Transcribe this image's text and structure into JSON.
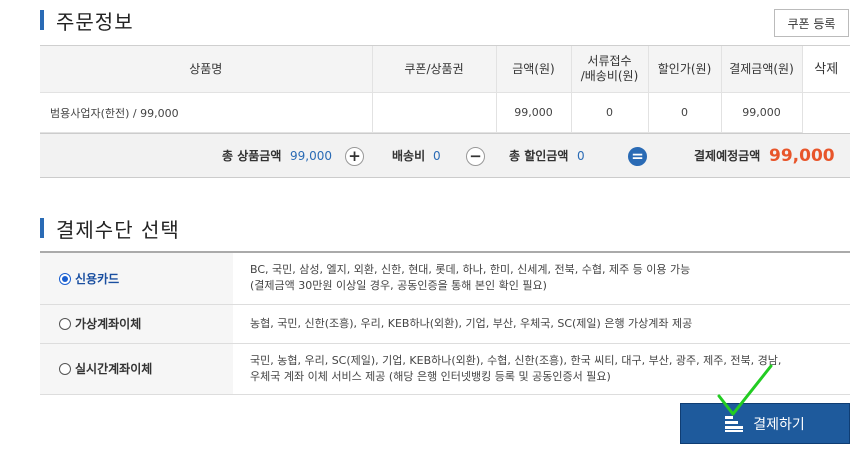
{
  "order_section": {
    "title": "주문정보",
    "coupon_button": "쿠폰 등록",
    "headers": [
      "상품명",
      "쿠폰/상품권",
      "금액(원)",
      "서류접수\n/배송비(원)",
      "할인가(원)",
      "결제금액(원)",
      "삭제"
    ],
    "rows": [
      {
        "name": "범용사업자(한전) / 99,000",
        "coupon": "",
        "amount": "99,000",
        "shipping": "0",
        "discount": "0",
        "payment": "99,000"
      }
    ],
    "totals": {
      "product_label": "총 상품금액",
      "product_value": "99,000",
      "shipping_label": "배송비",
      "shipping_value": "0",
      "discount_label": "총 할인금액",
      "discount_value": "0",
      "grand_label": "결제예정금액",
      "grand_value": "99,000",
      "plus": "+",
      "minus": "−",
      "equals": "="
    }
  },
  "payment_section": {
    "title": "결제수단 선택",
    "methods": [
      {
        "label": "신용카드",
        "selected": true,
        "desc1": "BC, 국민, 삼성, 엘지, 외환, 신한, 현대, 롯데, 하나, 한미, 신세계, 전북, 수협, 제주 등 이용 가능",
        "desc2": "(결제금액 30만원 이상일 경우, 공동인증을 통해 본인 확인 필요)"
      },
      {
        "label": "가상계좌이체",
        "selected": false,
        "desc1": "농협, 국민, 신한(조흥), 우리, KEB하나(외환), 기업, 부산, 우체국, SC(제일) 은행 가상계좌 제공",
        "desc2": ""
      },
      {
        "label": "실시간계좌이체",
        "selected": false,
        "desc1": "국민, 농협, 우리, SC(제일), 기업, KEB하나(외환), 수협, 신한(조흥), 한국 씨티, 대구, 부산, 광주, 제주, 전북, 경남,",
        "desc2": "우체국 계좌 이체 서비스 제공 (해당 은행 인터넷뱅킹 등록 및 공동인증서 필요)"
      }
    ],
    "pay_button": "결제하기"
  },
  "colors": {
    "accent": "#2a6bb5",
    "button": "#1e5a9c",
    "grand_total": "#e8552a",
    "annotation": "#22cc22"
  },
  "icons": {
    "pay_button_icon": "list-icon",
    "radio_on": "radio-checked-icon",
    "radio_off": "radio-unchecked-icon"
  }
}
